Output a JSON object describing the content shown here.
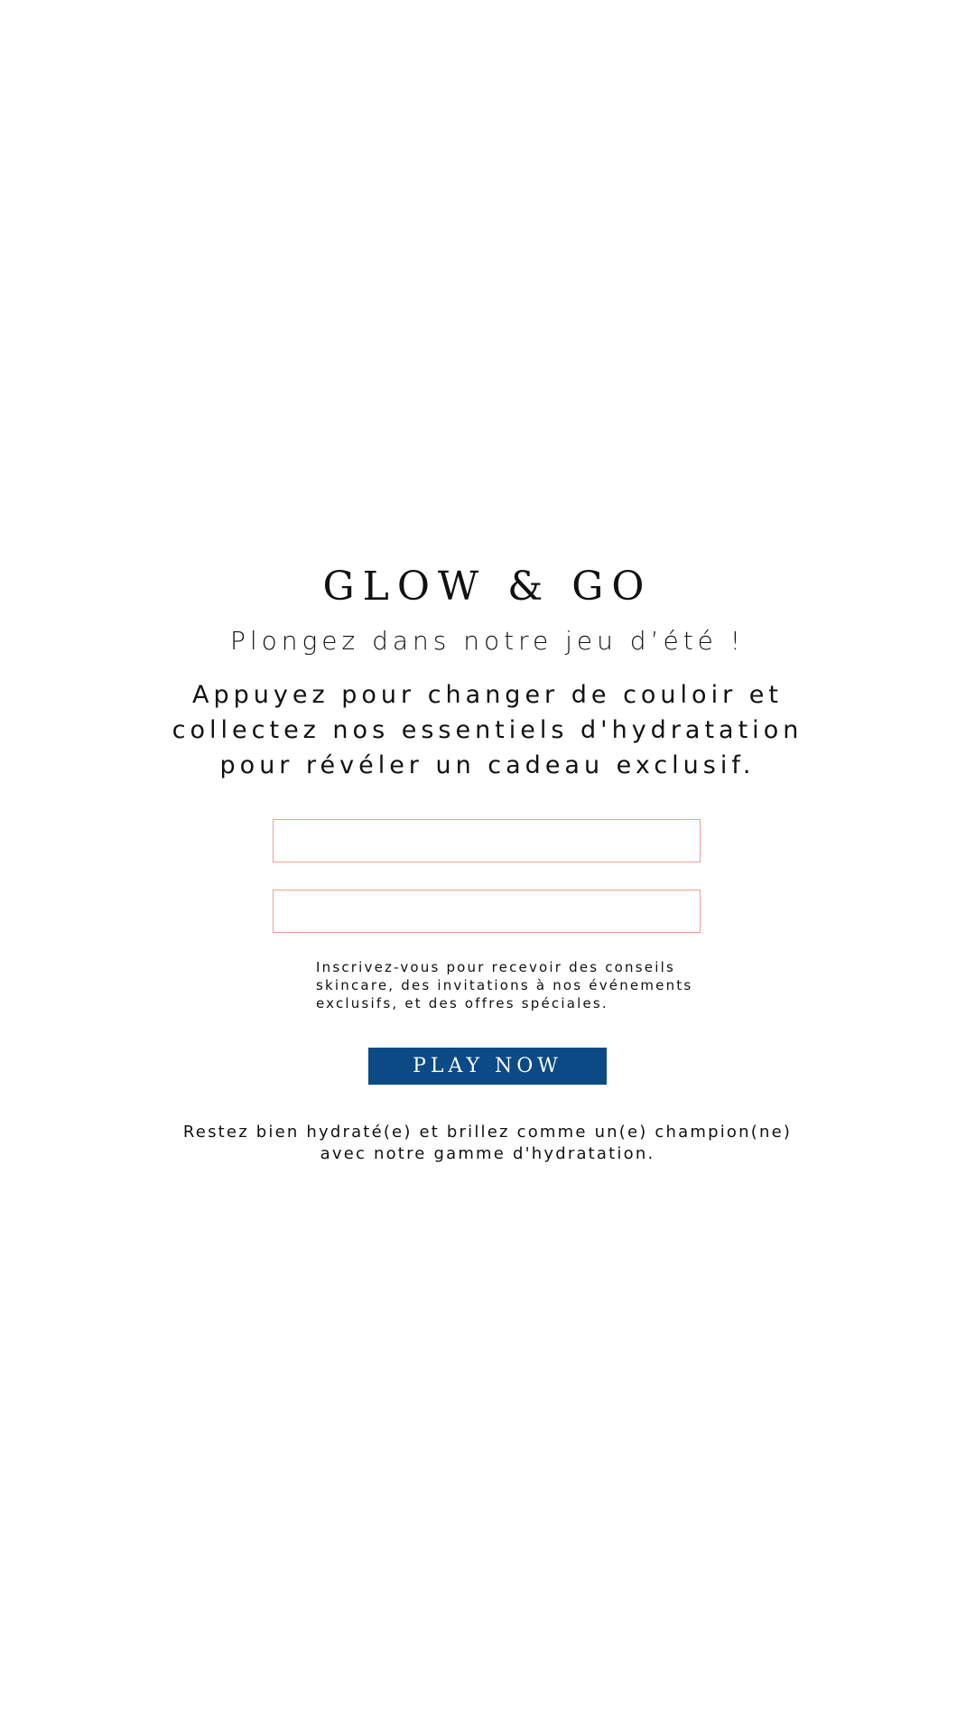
{
  "header": {
    "title": "GLOW & GO",
    "subtitle": "Plongez dans notre jeu d’été !",
    "description": "Appuyez pour changer de couloir et collectez nos essentiels d'hydratation pour révéler un cadeau exclusif."
  },
  "form": {
    "field_1": {
      "value": "",
      "placeholder": ""
    },
    "field_2": {
      "value": "",
      "placeholder": ""
    },
    "consent_text": "Inscrivez-vous pour recevoir des conseils skincare, des invitations à nos événements exclusifs, et des offres spéciales.",
    "play_button_label": "PLAY NOW"
  },
  "footer": {
    "text": "Restez bien hydraté(e) et brillez comme un(e) champion(ne) avec notre gamme d'hydratation."
  },
  "colors": {
    "accent_button": "#0b4a85",
    "input_border": "#f1a08c",
    "text": "#111111",
    "background": "#ffffff"
  }
}
